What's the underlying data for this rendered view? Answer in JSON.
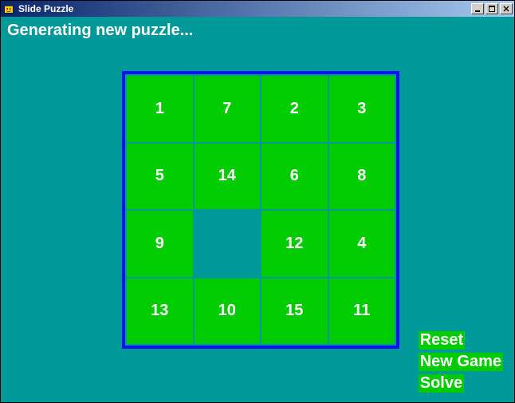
{
  "window": {
    "title": "Slide Puzzle"
  },
  "status": "Generating new puzzle...",
  "board": {
    "grid": [
      [
        "1",
        "7",
        "2",
        "3"
      ],
      [
        "5",
        "14",
        "6",
        "8"
      ],
      [
        "9",
        "",
        "12",
        "4"
      ],
      [
        "13",
        "10",
        "15",
        "11"
      ]
    ]
  },
  "tiles": {
    "r0c0": "1",
    "r0c1": "7",
    "r0c2": "2",
    "r0c3": "3",
    "r1c0": "5",
    "r1c1": "14",
    "r1c2": "6",
    "r1c3": "8",
    "r2c0": "9",
    "r2c1": "",
    "r2c2": "12",
    "r2c3": "4",
    "r3c0": "13",
    "r3c1": "10",
    "r3c2": "15",
    "r3c3": "11"
  },
  "actions": {
    "reset": "Reset",
    "new_game": "New Game",
    "solve": "Solve"
  },
  "colors": {
    "background": "#009999",
    "tile": "#00cc00",
    "tile_text": "#ffffff",
    "board_border": "#1010ff"
  }
}
